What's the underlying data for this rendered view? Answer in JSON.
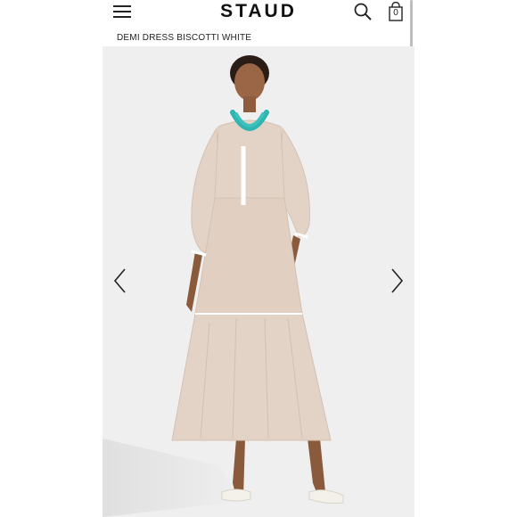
{
  "header": {
    "brand": "STAUD",
    "cart_count": "0"
  },
  "product": {
    "title": "DEMI DRESS BISCOTTI WHITE"
  },
  "icons": {
    "menu": "hamburger-menu-icon",
    "search": "search-icon",
    "bag": "shopping-bag-icon",
    "prev": "chevron-left-icon",
    "next": "chevron-right-icon"
  },
  "colors": {
    "dress": "#e3d3c6",
    "trim": "#ffffff",
    "necklace": "#2fb4b0",
    "background": "#efefef"
  }
}
